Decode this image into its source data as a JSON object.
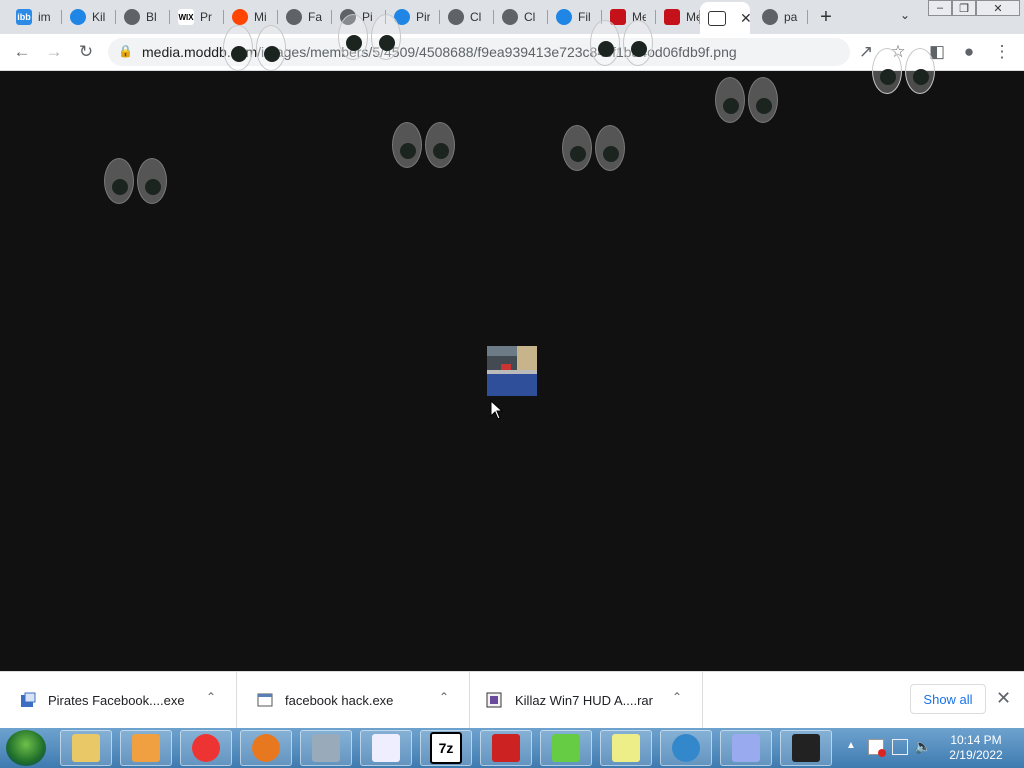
{
  "tabs": [
    {
      "icon": "ibb",
      "glyph": "ibb",
      "title": "im"
    },
    {
      "icon": "kb",
      "glyph": "",
      "title": "Kil"
    },
    {
      "icon": "globe",
      "glyph": "",
      "title": "Bl"
    },
    {
      "icon": "wix",
      "glyph": "WIX",
      "title": "Pr"
    },
    {
      "icon": "reddit",
      "glyph": "",
      "title": "Mi"
    },
    {
      "icon": "globe",
      "glyph": "",
      "title": "Fa"
    },
    {
      "icon": "globe",
      "glyph": "",
      "title": "Pi"
    },
    {
      "icon": "kb",
      "glyph": "",
      "title": "Pir"
    },
    {
      "icon": "globe",
      "glyph": "",
      "title": "Cl"
    },
    {
      "icon": "globe",
      "glyph": "",
      "title": "Cl"
    },
    {
      "icon": "kb",
      "glyph": "",
      "title": "Fil"
    },
    {
      "icon": "moddb",
      "glyph": "",
      "title": "Me"
    },
    {
      "icon": "moddb",
      "glyph": "",
      "title": "Me"
    },
    {
      "icon": "frame",
      "glyph": "",
      "title": ""
    },
    {
      "icon": "globe",
      "glyph": "",
      "title": "pa"
    }
  ],
  "toolbar": {
    "url_host": "media.moddb.com",
    "url_path": "/images/members/5/4509/4508688/f9ea939413e723c84cf1ba4od06fdb9f.png"
  },
  "downloads": [
    {
      "name": "Pirates Facebook....exe",
      "icon": "app-icon"
    },
    {
      "name": "facebook hack.exe",
      "icon": "window-icon"
    },
    {
      "name": "Killaz Win7 HUD A....rar",
      "icon": "archive-icon"
    }
  ],
  "download_bar": {
    "show_all": "Show all"
  },
  "taskbar": {
    "pinned": [
      "explorer",
      "media-player",
      "chrome",
      "firefox",
      "network-tool",
      "notepad-list",
      "7-zip",
      "pirate-game",
      "green-character",
      "edit-tool",
      "facebook",
      "installer",
      "game-app"
    ],
    "seven_zip_label": "7z"
  },
  "clock": {
    "time": "10:14 PM",
    "date": "2/19/2022"
  }
}
